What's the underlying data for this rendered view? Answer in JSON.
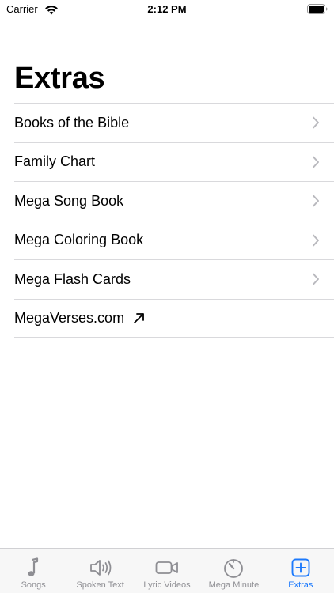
{
  "status_bar": {
    "carrier": "Carrier",
    "time": "2:12 PM"
  },
  "page": {
    "title": "Extras"
  },
  "list": {
    "items": [
      {
        "label": "Books of the Bible",
        "accessory": "chevron-right-icon"
      },
      {
        "label": "Family Chart",
        "accessory": "chevron-right-icon"
      },
      {
        "label": "Mega Song Book",
        "accessory": "chevron-right-icon"
      },
      {
        "label": "Mega Coloring Book",
        "accessory": "chevron-right-icon"
      },
      {
        "label": "Mega Flash Cards",
        "accessory": "chevron-right-icon"
      },
      {
        "label": "MegaVerses.com",
        "accessory": "external-link-arrow-icon"
      }
    ]
  },
  "tab_bar": {
    "active": "Extras",
    "active_color": "#1d7afc",
    "inactive_color": "#8e8e93",
    "tabs": [
      {
        "label": "Songs",
        "icon": "music-note-icon"
      },
      {
        "label": "Spoken Text",
        "icon": "speaker-icon"
      },
      {
        "label": "Lyric Videos",
        "icon": "video-camera-icon"
      },
      {
        "label": "Mega Minute",
        "icon": "timer-icon"
      },
      {
        "label": "Extras",
        "icon": "plus-square-icon"
      }
    ]
  }
}
